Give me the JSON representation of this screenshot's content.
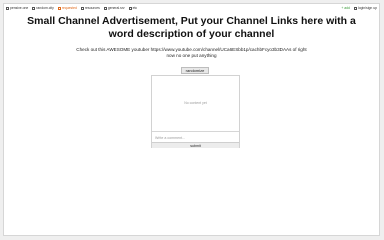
{
  "nav": {
    "left": [
      {
        "label": "pensive.one",
        "icon": "page-icon"
      },
      {
        "label": "random.city",
        "icon": "page-icon"
      },
      {
        "label": "requested",
        "icon": "page-icon",
        "active": true
      },
      {
        "label": "resources",
        "icon": "page-icon"
      },
      {
        "label": "general.srv",
        "icon": "page-icon"
      },
      {
        "label": "etc",
        "icon": "page-icon"
      }
    ],
    "add_label": "+ add",
    "login_label": "login/sign up"
  },
  "content": {
    "title": "Small Channel Advertisement, Put your Channel Links here with a word description of your channel",
    "description": "Check out this AWESOME youtuber https://www.youtube.com/channel/UCa6ESbb1p/cachbFcyo3b3DAAs of right now no one put anything",
    "randomize_label": "randomize",
    "empty_text": "No content yet",
    "comment_placeholder": "Write a comment...",
    "submit_label": "submit"
  },
  "colors": {
    "accent": "#e06a1b",
    "add": "#3a9a3a"
  }
}
